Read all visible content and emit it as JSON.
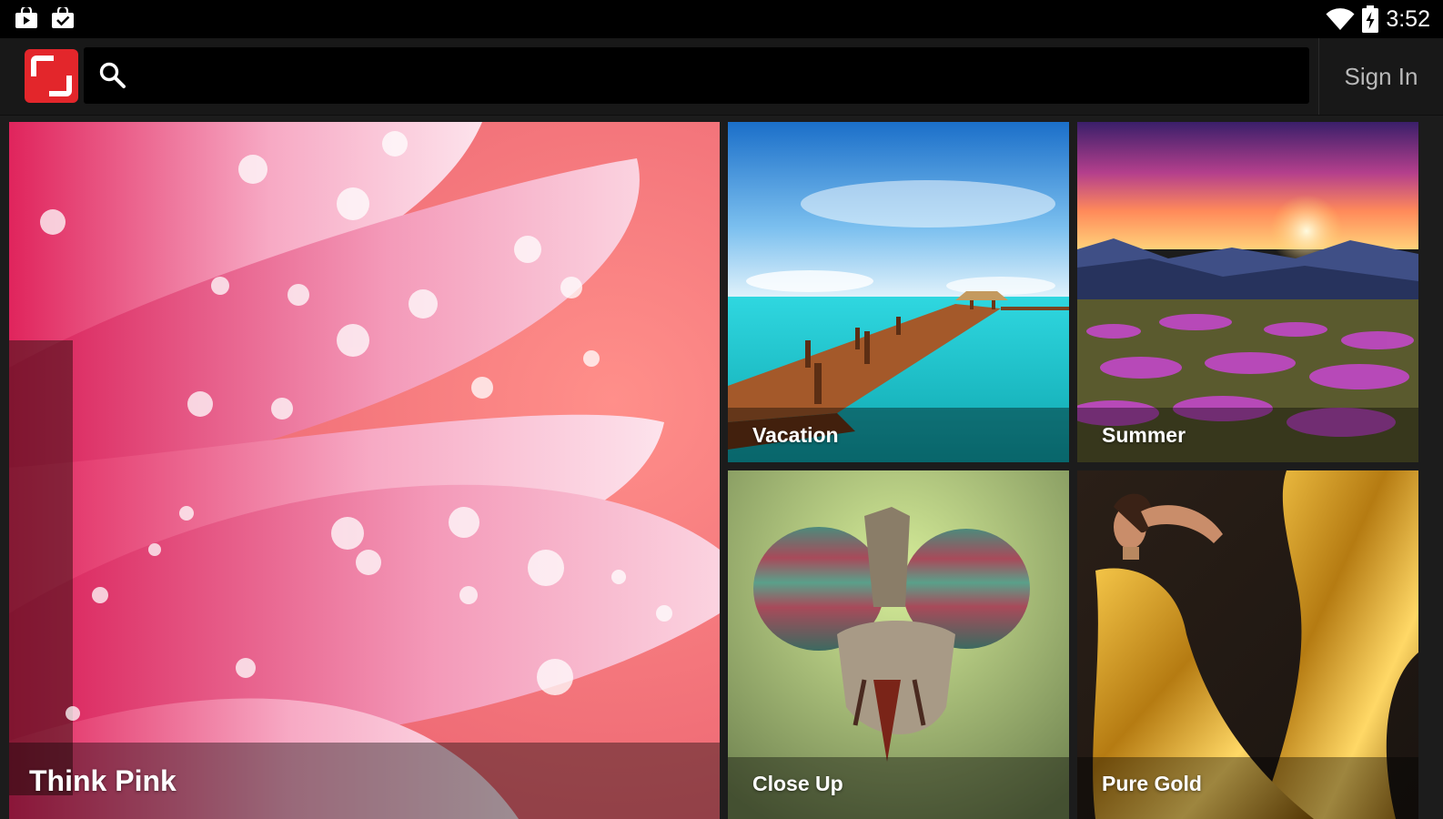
{
  "status_bar": {
    "time": "3:52",
    "icons": [
      "shopping-bag-icon",
      "task-check-icon",
      "wifi-icon",
      "battery-charging-icon"
    ]
  },
  "app_bar": {
    "logo_icon": "app-logo-icon",
    "search": {
      "icon": "search-icon",
      "value": "",
      "placeholder": ""
    },
    "sign_in_label": "Sign In"
  },
  "tiles": [
    {
      "title": "Think Pink",
      "image": "pink flower petals with water droplets"
    },
    {
      "title": "Vacation",
      "image": "wooden pier over turquoise sea"
    },
    {
      "title": "Summer",
      "image": "purple flower meadow at sunset"
    },
    {
      "title": "Close Up",
      "image": "macro of fly head with striped eyes"
    },
    {
      "title": "Pure Gold",
      "image": "woman in flowing golden fabric"
    }
  ],
  "colors": {
    "brand": "#e3262b",
    "app_bar": "#181818",
    "status_bar": "#000000"
  }
}
